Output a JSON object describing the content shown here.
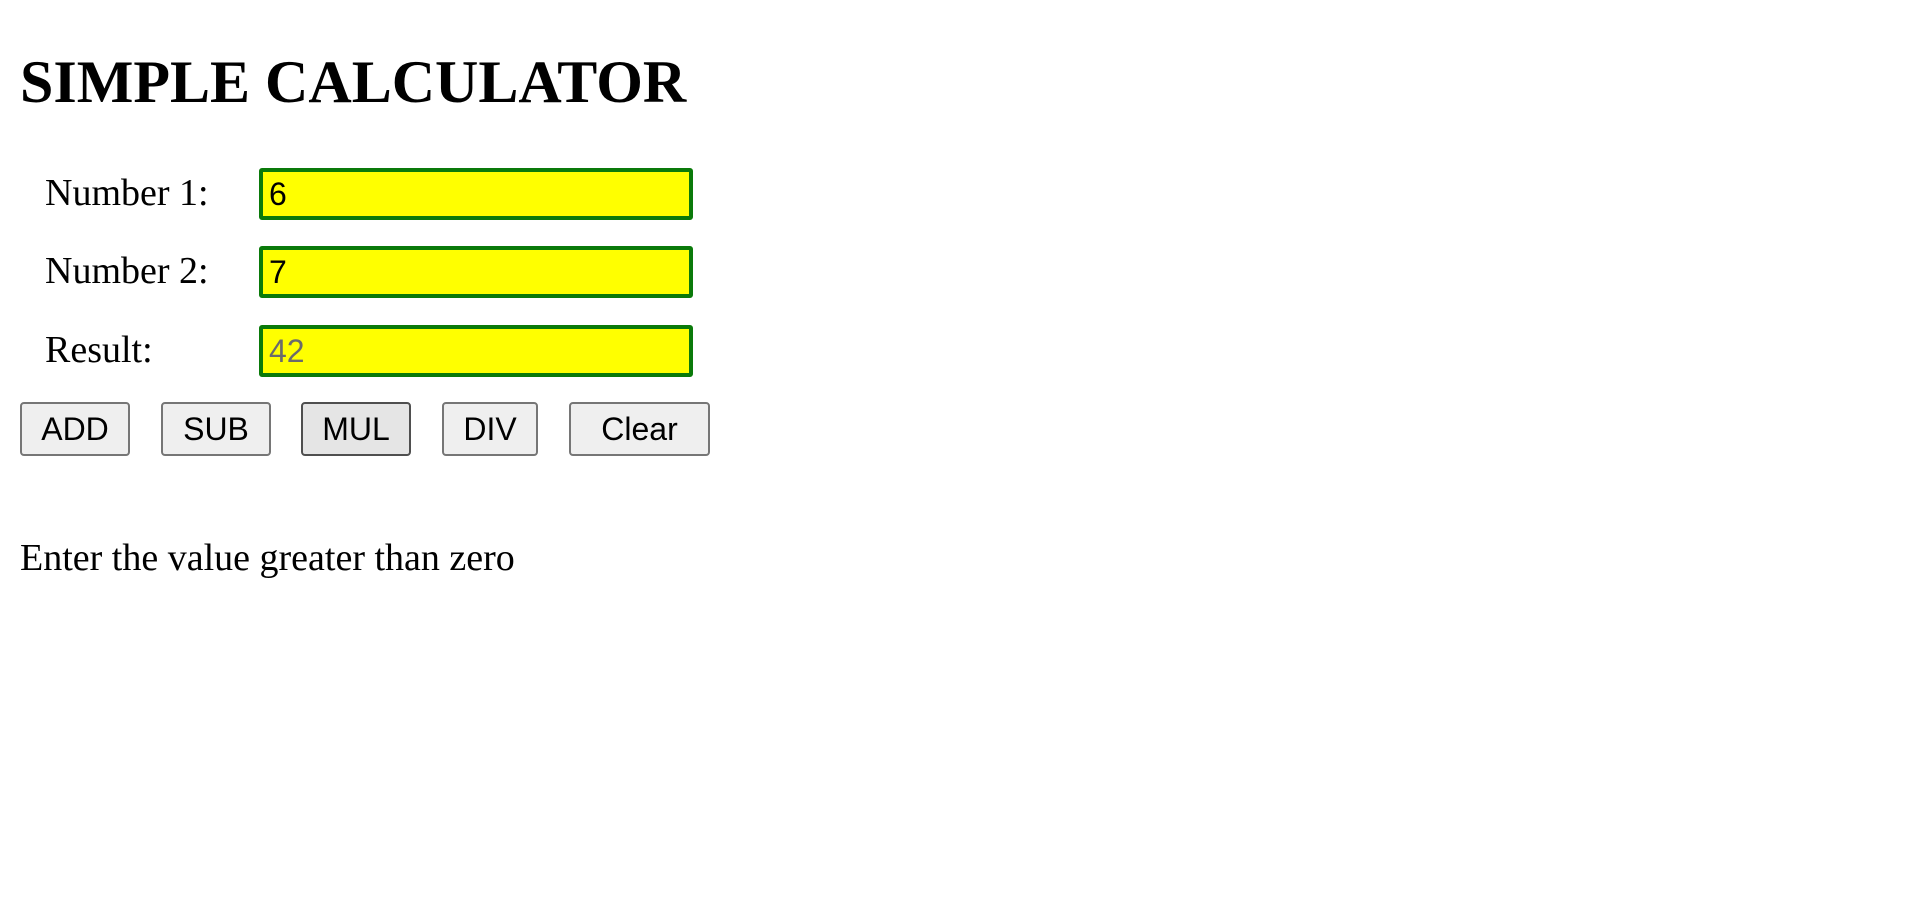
{
  "page": {
    "title": "SIMPLE CALCULATOR"
  },
  "form": {
    "number1": {
      "label": "Number 1:",
      "value": "6"
    },
    "number2": {
      "label": "Number 2:",
      "value": "7"
    },
    "result": {
      "label": "Result:",
      "value": "42"
    }
  },
  "buttons": {
    "add": "ADD",
    "sub": "SUB",
    "mul": "MUL",
    "div": "DIV",
    "clear": "Clear"
  },
  "message": "Enter the value greater than zero",
  "colors": {
    "field_background": "#ffff00",
    "field_border": "#0a7a0a",
    "button_background": "#efefef"
  }
}
